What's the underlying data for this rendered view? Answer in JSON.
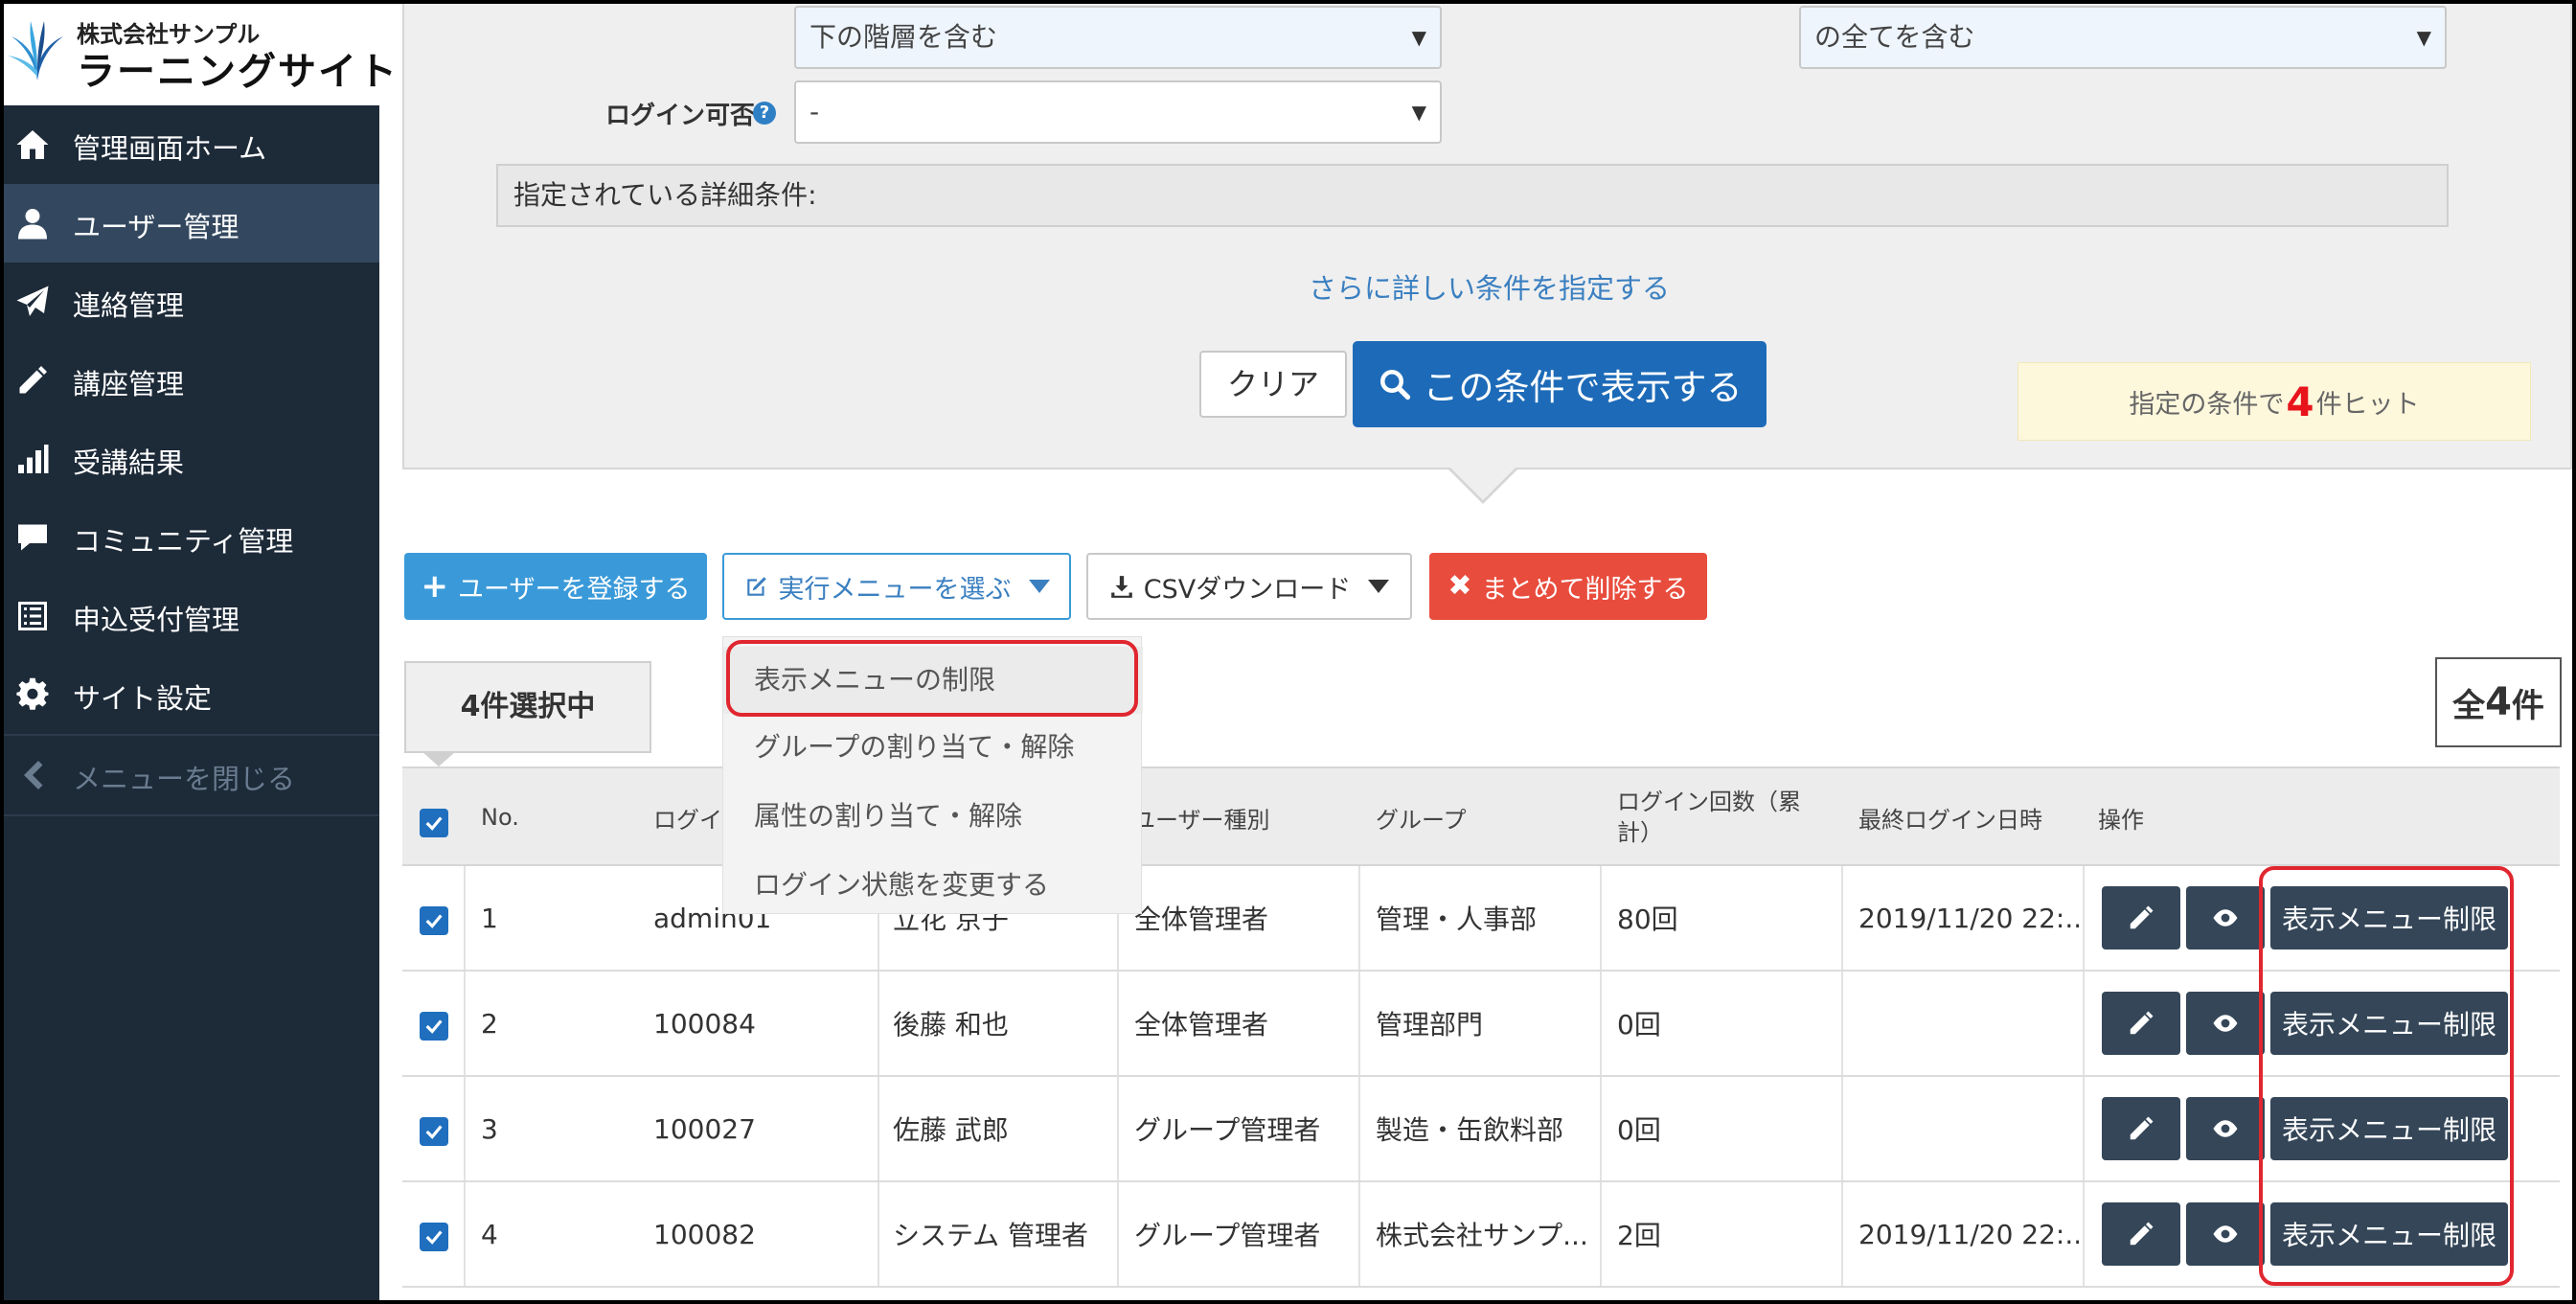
{
  "sidebar": {
    "logo": {
      "company": "株式会社サンプル",
      "site": "ラーニングサイト"
    },
    "items": [
      {
        "label": "管理画面ホーム",
        "icon": "home-icon"
      },
      {
        "label": "ユーザー管理",
        "icon": "user-icon",
        "active": true
      },
      {
        "label": "連絡管理",
        "icon": "paper-plane-icon"
      },
      {
        "label": "講座管理",
        "icon": "pencil-icon"
      },
      {
        "label": "受講結果",
        "icon": "bar-chart-icon"
      },
      {
        "label": "コミュニティ管理",
        "icon": "comment-icon"
      },
      {
        "label": "申込受付管理",
        "icon": "list-icon"
      },
      {
        "label": "サイト設定",
        "icon": "gear-icon"
      }
    ],
    "close_label": "メニューを閉じる"
  },
  "filter": {
    "hierarchy_select": "下の階層を含む",
    "match_select": "の全てを含む",
    "login_label": "ログイン可否",
    "login_select": "-",
    "conditions_label": "指定されている詳細条件:",
    "more_conditions_link": "さらに詳しい条件を指定する",
    "clear_button": "クリア",
    "search_button": "この条件で表示する",
    "hit_prefix": "指定の条件で",
    "hit_count": "4",
    "hit_suffix": "件ヒット"
  },
  "actions": {
    "register_button": "ユーザーを登録する",
    "menu_button": "実行メニューを選ぶ",
    "csv_button": "CSVダウンロード",
    "delete_button": "まとめて削除する"
  },
  "dropdown": {
    "items": [
      "表示メニューの制限",
      "グループの割り当て・解除",
      "属性の割り当て・解除",
      "ログイン状態を変更する"
    ]
  },
  "selection": {
    "selected_label": "4件選択中",
    "total_prefix": "全",
    "total_count": "4",
    "total_suffix": "件"
  },
  "table": {
    "headers": {
      "no": "No.",
      "login_id": "ログイ",
      "user_type": "ユーザー種別",
      "group": "グループ",
      "login_count": "ログイン回数（累計）",
      "last_login": "最終ログイン日時",
      "ops": "操作"
    },
    "rows": [
      {
        "no": "1",
        "login_id": "admin01",
        "name": "立花 京子",
        "user_type": "全体管理者",
        "group": "管理・人事部",
        "login_count": "80回",
        "last_login": "2019/11/20 22:...",
        "restrict": "表示メニュー制限"
      },
      {
        "no": "2",
        "login_id": "100084",
        "name": "後藤 和也",
        "user_type": "全体管理者",
        "group": "管理部門",
        "login_count": "0回",
        "last_login": "",
        "restrict": "表示メニュー制限"
      },
      {
        "no": "3",
        "login_id": "100027",
        "name": "佐藤 武郎",
        "user_type": "グループ管理者",
        "group": "製造・缶飲料部",
        "login_count": "0回",
        "last_login": "",
        "restrict": "表示メニュー制限"
      },
      {
        "no": "4",
        "login_id": "100082",
        "name": "システム 管理者",
        "user_type": "グループ管理者",
        "group": "株式会社サンプ...",
        "login_count": "2回",
        "last_login": "2019/11/20 22:...",
        "restrict": "表示メニュー制限"
      }
    ]
  },
  "colors": {
    "sidebar_bg": "#1d2a38",
    "sidebar_active": "#33485f",
    "primary": "#1d6bb8",
    "register": "#3a9ad9",
    "danger": "#e84c3d",
    "dark_button": "#344658",
    "highlight": "#e0262f",
    "hit_number": "#e8141c"
  }
}
